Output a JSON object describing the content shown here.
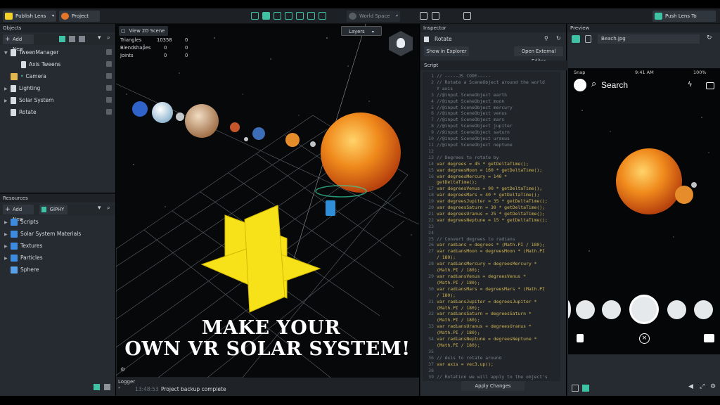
{
  "topbar": {
    "publish_lens": "Publish Lens",
    "project_info": "Project Info",
    "world_space": "World Space",
    "push_lens": "Push Lens To Device"
  },
  "objects": {
    "title": "Objects",
    "add_new": "Add New",
    "items": [
      {
        "label": "TweenManager",
        "indent": 0
      },
      {
        "label": "Axis Tweens",
        "indent": 1
      },
      {
        "label": "Camera",
        "indent": 0
      },
      {
        "label": "Lighting",
        "indent": 0
      },
      {
        "label": "Solar System",
        "indent": 0
      },
      {
        "label": "Rotate",
        "indent": 0
      }
    ]
  },
  "resources": {
    "title": "Resources",
    "add_new": "Add New",
    "giphy": "GIPHY",
    "items": [
      "Scripts",
      "Solar System Materials",
      "Textures",
      "Particles",
      "Sphere"
    ]
  },
  "scene": {
    "view2d": "View 2D Scene",
    "layers": "Layers",
    "stats": [
      {
        "label": "Triangles",
        "a": "10358",
        "b": "0"
      },
      {
        "label": "Blendshapes",
        "a": "0",
        "b": "0"
      },
      {
        "label": "Joints",
        "a": "0",
        "b": "0"
      }
    ],
    "overlay_line1": "MAKE  YOUR",
    "overlay_line2": "OWN VR SOLAR SYSTEM!"
  },
  "logger": {
    "title": "Logger",
    "time": "13:48:53",
    "message": "Project backup complete"
  },
  "inspector": {
    "title": "Inspector",
    "object_name": "Rotate",
    "show_in_explorer": "Show in Explorer",
    "open_external": "Open External Editor",
    "script_title": "Script",
    "apply_changes": "Apply Changes",
    "code": [
      {
        "n": "1",
        "t": "// -----JS CODE-----",
        "c": "cm"
      },
      {
        "n": "2",
        "t": "// Rotate a SceneObject around the world",
        "c": "cm"
      },
      {
        "n": "",
        "t": "Y axis",
        "c": "cm"
      },
      {
        "n": "3",
        "t": "//@input SceneObject earth",
        "c": "cm"
      },
      {
        "n": "4",
        "t": "//@input SceneObject moon",
        "c": "cm"
      },
      {
        "n": "5",
        "t": "//@input SceneObject mercury",
        "c": "cm"
      },
      {
        "n": "6",
        "t": "//@input SceneObject venus",
        "c": "cm"
      },
      {
        "n": "7",
        "t": "//@input SceneObject mars",
        "c": "cm"
      },
      {
        "n": "8",
        "t": "//@input SceneObject jupiter",
        "c": "cm"
      },
      {
        "n": "9",
        "t": "//@input SceneObject saturn",
        "c": "cm"
      },
      {
        "n": "10",
        "t": "//@input SceneObject uranus",
        "c": "cm"
      },
      {
        "n": "11",
        "t": "//@input SceneObject neptune",
        "c": "cm"
      },
      {
        "n": "12",
        "t": "",
        "c": "nm"
      },
      {
        "n": "13",
        "t": "// Degrees to rotate by",
        "c": "cm"
      },
      {
        "n": "14",
        "t": "var degrees = 45 * getDeltaTime();",
        "c": "kw"
      },
      {
        "n": "15",
        "t": "var degreesMoon = 160 * getDeltaTime();",
        "c": "kw"
      },
      {
        "n": "16",
        "t": "var degreesMercury = 140 *",
        "c": "kw"
      },
      {
        "n": "",
        "t": "getDeltaTime();",
        "c": "kw"
      },
      {
        "n": "17",
        "t": "var degreesVenus = 90 * getDeltaTime();",
        "c": "kw"
      },
      {
        "n": "18",
        "t": "var degreesMars = 40 * getDeltaTime();",
        "c": "kw"
      },
      {
        "n": "19",
        "t": "var degreesJupiter = 35 * getDeltaTime();",
        "c": "kw"
      },
      {
        "n": "20",
        "t": "var degreesSaturn = 30 * getDeltaTime();",
        "c": "kw"
      },
      {
        "n": "21",
        "t": "var degreesUranus = 25 * getDeltaTime();",
        "c": "kw"
      },
      {
        "n": "22",
        "t": "var degreesNeptune = 15 * getDeltaTime();",
        "c": "kw"
      },
      {
        "n": "23",
        "t": "",
        "c": "nm"
      },
      {
        "n": "24",
        "t": "",
        "c": "nm"
      },
      {
        "n": "25",
        "t": "// Convert degrees to radians",
        "c": "cm"
      },
      {
        "n": "26",
        "t": "var radians = degrees * (Math.PI / 180);",
        "c": "kw"
      },
      {
        "n": "27",
        "t": "var radiansMoon = degreesMoon * (Math.PI",
        "c": "kw"
      },
      {
        "n": "",
        "t": "/ 180);",
        "c": "kw"
      },
      {
        "n": "28",
        "t": "var radiansMercury = degreesMercury *",
        "c": "kw"
      },
      {
        "n": "",
        "t": "(Math.PI / 180);",
        "c": "kw"
      },
      {
        "n": "29",
        "t": "var radiansVenus = degreesVenus *",
        "c": "kw"
      },
      {
        "n": "",
        "t": "(Math.PI / 180);",
        "c": "kw"
      },
      {
        "n": "30",
        "t": "var radiansMars = degreesMars * (Math.PI",
        "c": "kw"
      },
      {
        "n": "",
        "t": "/ 180);",
        "c": "kw"
      },
      {
        "n": "31",
        "t": "var radiansJupiter = degreesJupiter *",
        "c": "kw"
      },
      {
        "n": "",
        "t": "(Math.PI / 180);",
        "c": "kw"
      },
      {
        "n": "32",
        "t": "var radiansSaturn = degreesSaturn *",
        "c": "kw"
      },
      {
        "n": "",
        "t": "(Math.PI / 180);",
        "c": "kw"
      },
      {
        "n": "33",
        "t": "var radiansUranus = degreesUranus *",
        "c": "kw"
      },
      {
        "n": "",
        "t": "(Math.PI / 180);",
        "c": "kw"
      },
      {
        "n": "34",
        "t": "var radiansNeptune = degreesNeptune *",
        "c": "kw"
      },
      {
        "n": "",
        "t": "(Math.PI / 180);",
        "c": "kw"
      },
      {
        "n": "35",
        "t": "",
        "c": "nm"
      },
      {
        "n": "36",
        "t": "// Axis to rotate around",
        "c": "cm"
      },
      {
        "n": "37",
        "t": "var axis = vec3.up();",
        "c": "kw"
      },
      {
        "n": "38",
        "t": "",
        "c": "nm"
      },
      {
        "n": "39",
        "t": "// Rotation we will apply to the object's",
        "c": "cm"
      }
    ]
  },
  "preview": {
    "title": "Preview",
    "image_name": "Beach.jpg",
    "status_left": "Snap",
    "status_time": "9:41 AM",
    "status_battery": "100%",
    "search": "Search"
  },
  "colors": {
    "accent": "#3ec2a3",
    "folder": "#3d8be0",
    "sun": "#f08a1c"
  }
}
